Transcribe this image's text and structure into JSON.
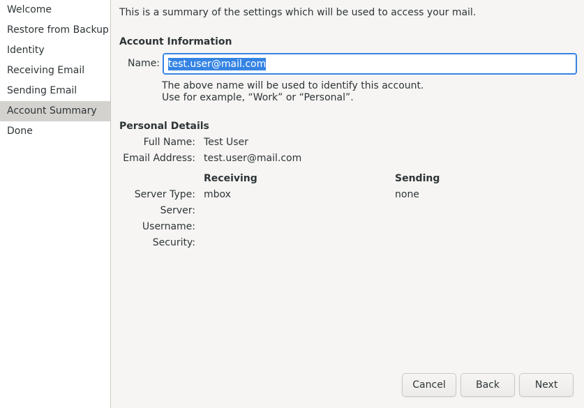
{
  "sidebar": {
    "items": [
      {
        "label": "Welcome"
      },
      {
        "label": "Restore from Backup"
      },
      {
        "label": "Identity"
      },
      {
        "label": "Receiving Email"
      },
      {
        "label": "Sending Email"
      },
      {
        "label": "Account Summary"
      },
      {
        "label": "Done"
      }
    ],
    "active_index": 5
  },
  "intro": "This is a summary of the settings which will be used to access your mail.",
  "account_info": {
    "heading": "Account Information",
    "name_label": "Name:",
    "name_value": "test.user@mail.com",
    "hint_line1": "The above name will be used to identify this account.",
    "hint_line2": "Use for example, “Work” or “Personal”."
  },
  "personal": {
    "heading": "Personal Details",
    "full_name_label": "Full Name:",
    "full_name": "Test User",
    "email_label": "Email Address:",
    "email": "test.user@mail.com"
  },
  "servers": {
    "receiving_heading": "Receiving",
    "sending_heading": "Sending",
    "server_type_label": "Server Type:",
    "server_label": "Server:",
    "username_label": "Username:",
    "security_label": "Security:",
    "receiving": {
      "server_type": "mbox",
      "server": "",
      "username": "",
      "security": ""
    },
    "sending": {
      "server_type": "none",
      "server": "",
      "username": "",
      "security": ""
    }
  },
  "buttons": {
    "cancel": "Cancel",
    "back": "Back",
    "next": "Next"
  },
  "colors": {
    "selection": "#3584e4",
    "active_sidebar": "#d4d2cf",
    "background": "#f6f5f4"
  }
}
